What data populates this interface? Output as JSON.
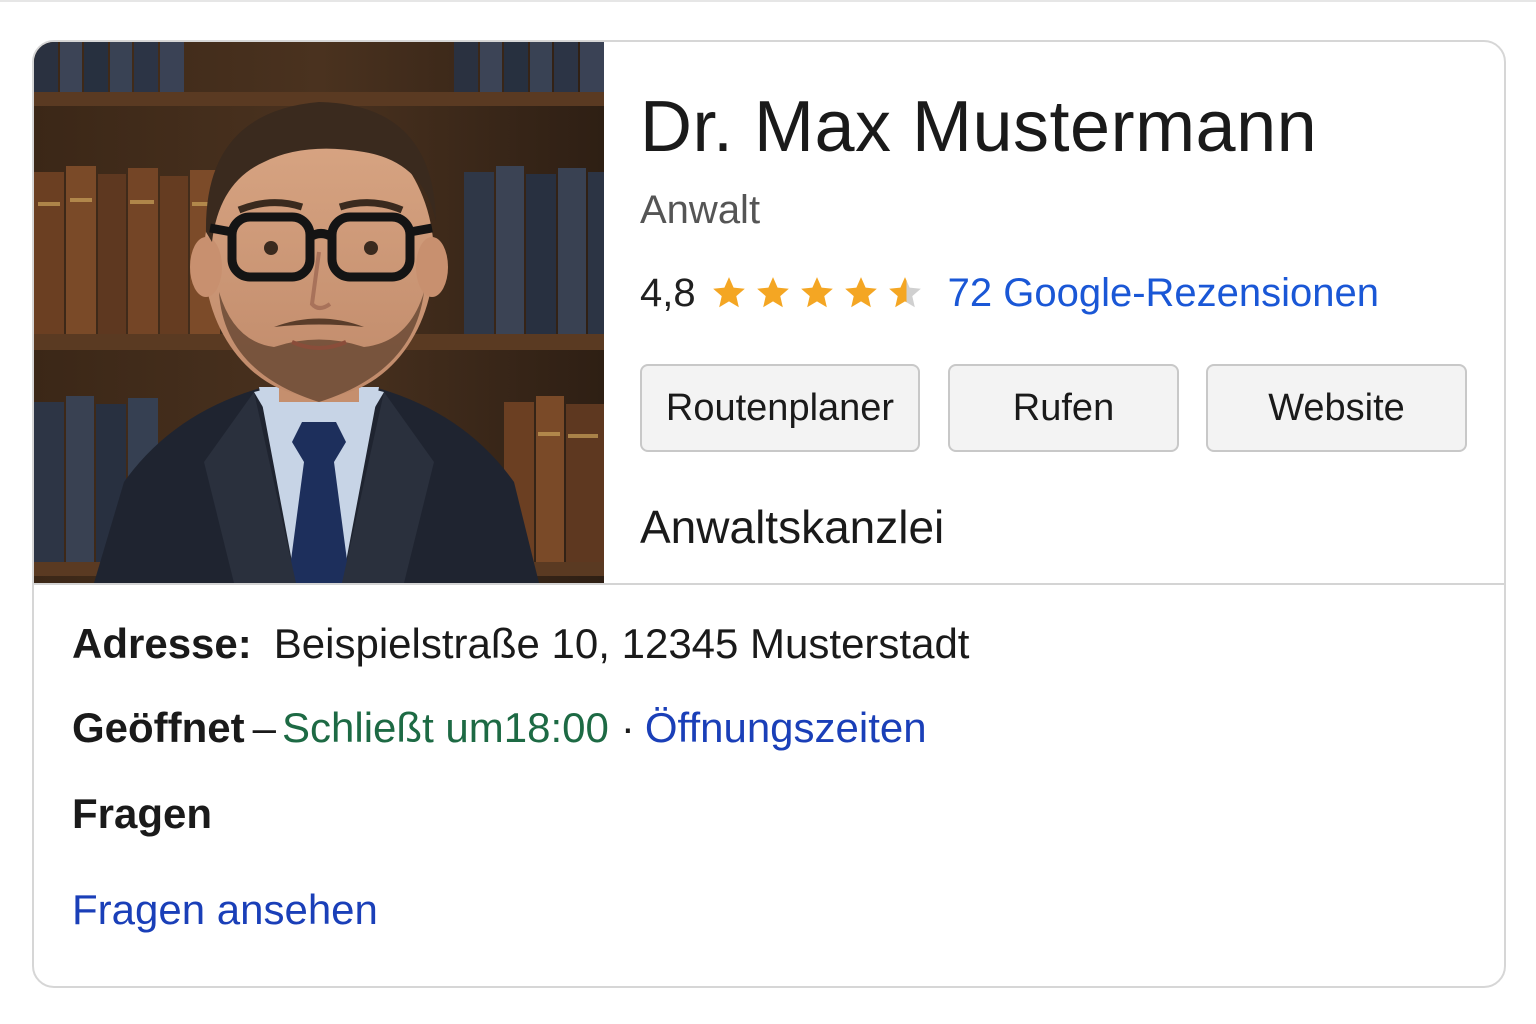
{
  "profile": {
    "name": "Dr. Max Mustermann",
    "category": "Anwalt",
    "rating": "4,8",
    "rating_value": 4.8,
    "rating_max": 5,
    "reviews_link": "72 Google-Rezensionen",
    "firm_type": "Anwaltskanzlei"
  },
  "actions": {
    "route": "Routenplaner",
    "call": "Rufen",
    "website": "Website"
  },
  "details": {
    "address_label": "Adresse:",
    "address_value": "Beispielstraße 10, 12345 Musterstadt",
    "hours_status": "Geöffnet",
    "hours_separator": "–",
    "hours_closes": "Schließt um18:00",
    "hours_dot": "·",
    "hours_link": "Öffnungszeiten",
    "questions_heading": "Fragen",
    "questions_link": "Fragen ansehen"
  },
  "colors": {
    "star": "#f4a623",
    "star_empty": "#d0d0d0",
    "link": "#1a57d6",
    "open_status": "#1d6a44"
  },
  "icons": {
    "star": "star-icon"
  }
}
